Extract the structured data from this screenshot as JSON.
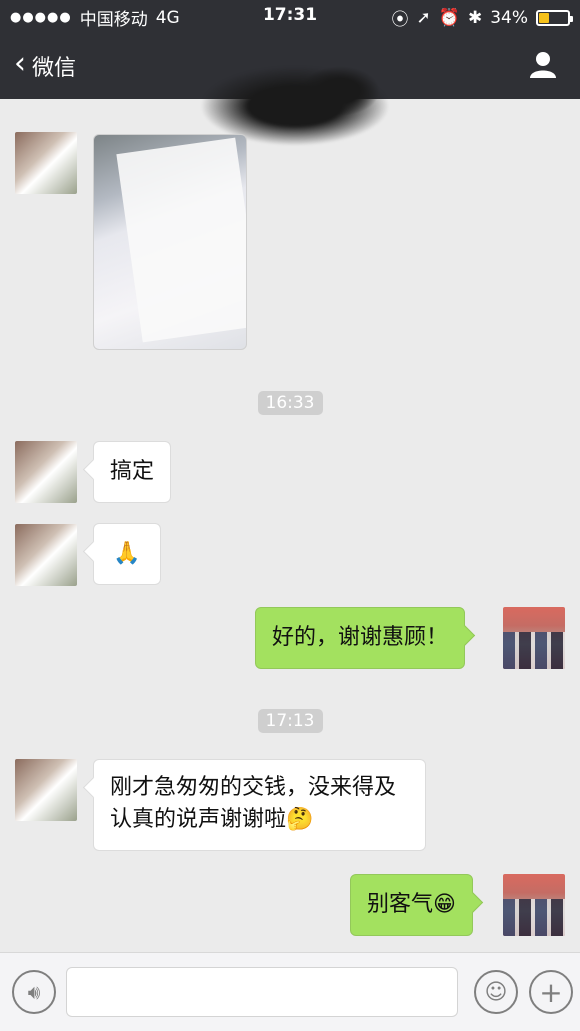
{
  "status": {
    "carrier": "中国移动",
    "network": "4G",
    "time": "17:31",
    "battery_percent": "34%",
    "battery_level": 0.34
  },
  "nav": {
    "back_label": "微信"
  },
  "messages": [
    {
      "type": "image",
      "side": "left"
    },
    {
      "type": "timestamp",
      "text": "16:33"
    },
    {
      "type": "text",
      "side": "left",
      "text": "搞定"
    },
    {
      "type": "sticker",
      "side": "left",
      "icon": "thanks-hands-icon",
      "text": "🙏"
    },
    {
      "type": "text",
      "side": "right",
      "text": "好的，谢谢惠顾！"
    },
    {
      "type": "timestamp",
      "text": "17:13"
    },
    {
      "type": "text",
      "side": "left",
      "text": "刚才急匆匆的交钱，没来得及认真的说声谢谢啦🤔"
    },
    {
      "type": "text",
      "side": "right",
      "text": "别客气😁"
    }
  ],
  "input": {
    "placeholder": ""
  }
}
